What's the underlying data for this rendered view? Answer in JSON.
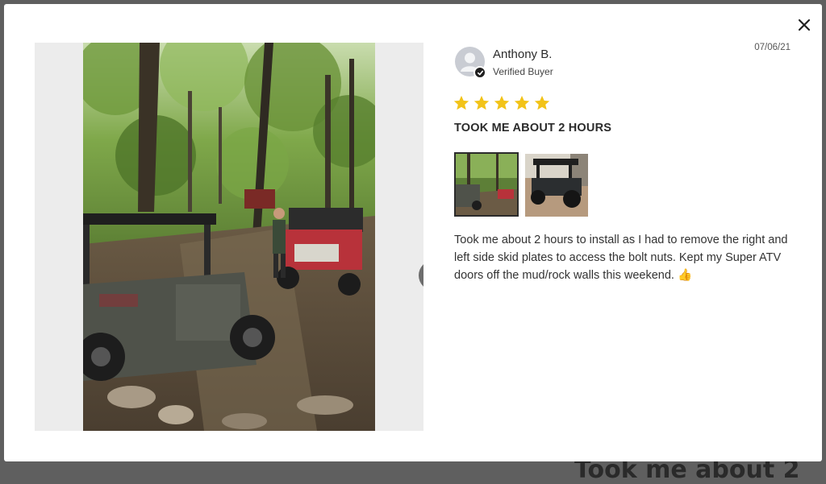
{
  "backdrop": {
    "peek_text": "Took me about 2"
  },
  "review": {
    "author": "Anthony B.",
    "verified_label": "Verified Buyer",
    "date": "07/06/21",
    "rating": 5,
    "rating_max": 5,
    "title": "TOOK ME ABOUT 2 HOURS",
    "body": "Took me about 2 hours to install as I had to remove the right and left side skid plates to access the bolt nuts. Kept my Super ATV doors off the mud/rock walls this weekend. 👍"
  },
  "media": {
    "main_photo_icon": "photo-offroad-trail",
    "next_icon": "chevron-right-icon",
    "thumbnails": [
      {
        "icon": "thumbnail-trail-photo",
        "selected": true
      },
      {
        "icon": "thumbnail-utv-photo",
        "selected": false
      }
    ]
  },
  "colors": {
    "star": "#f2c318",
    "overlay": "#5f5f5f",
    "text": "#2b2b2b"
  }
}
